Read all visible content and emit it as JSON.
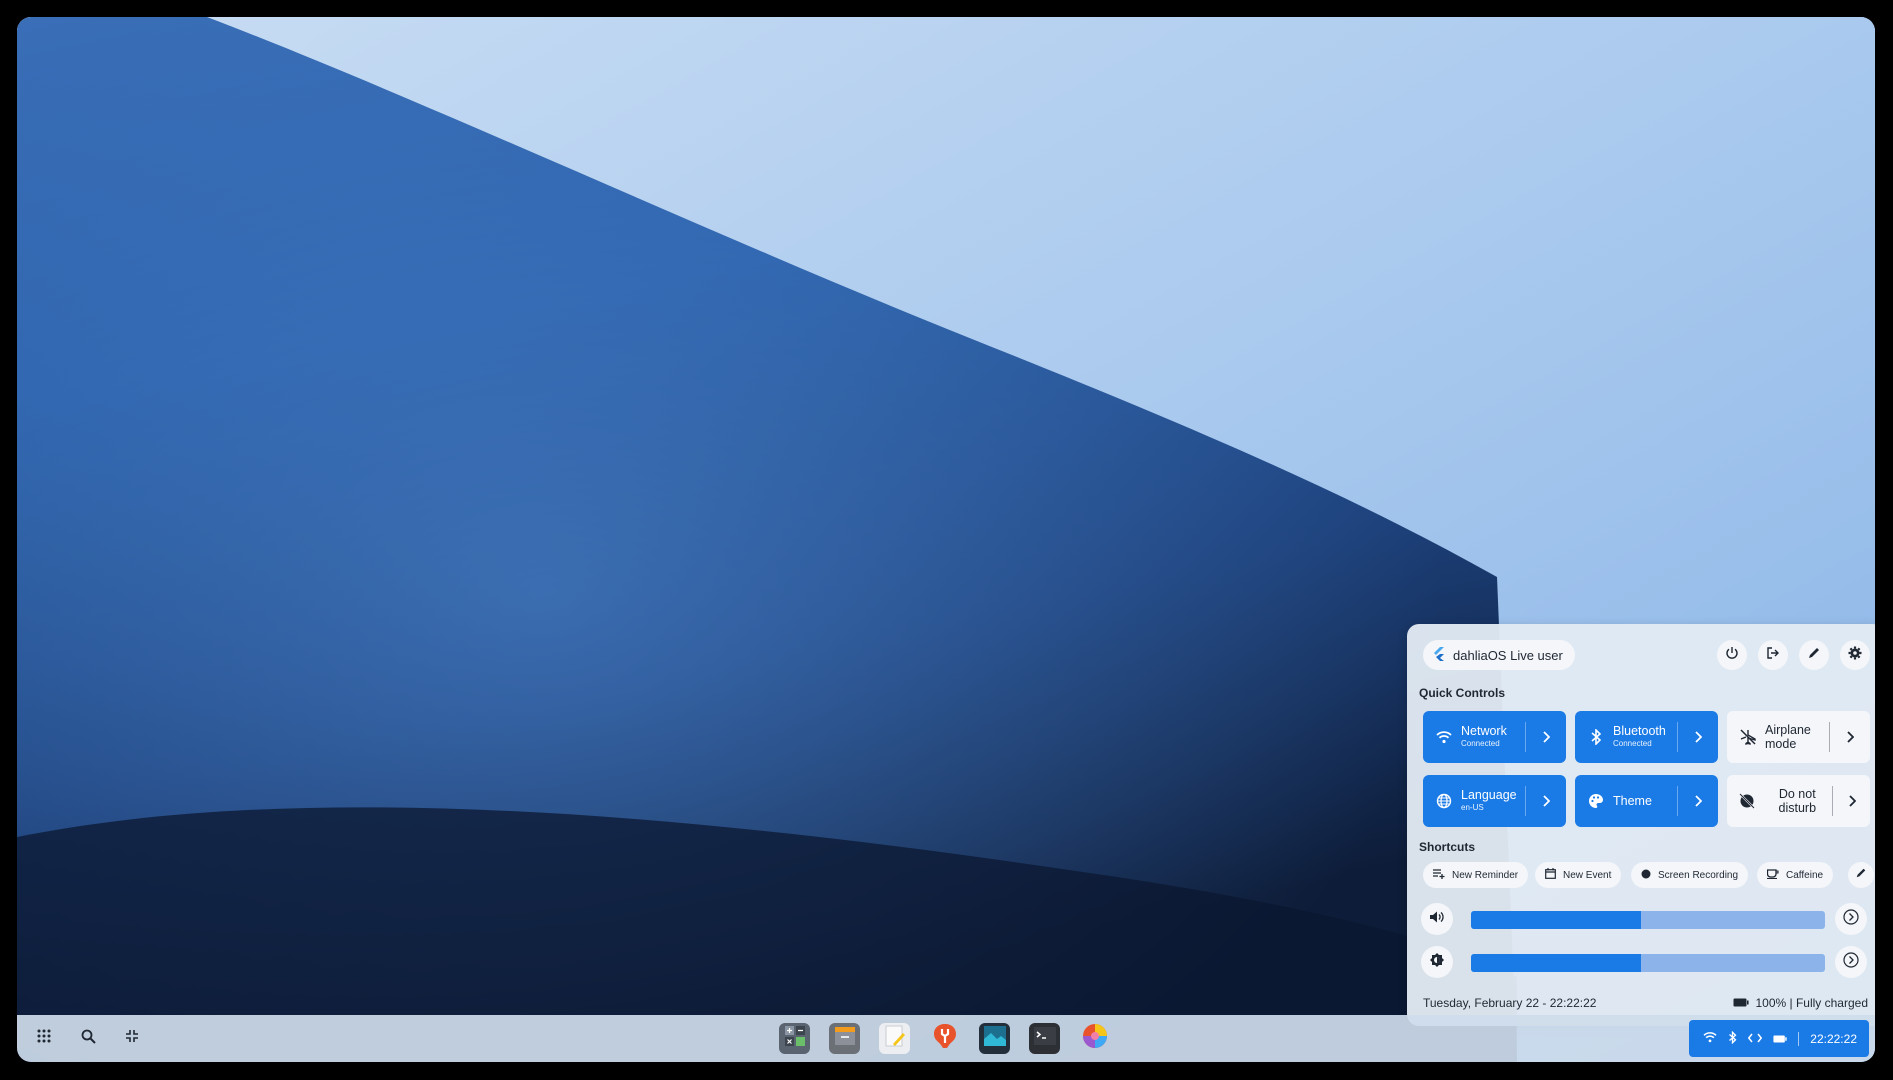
{
  "panel": {
    "user_label": "dahliaOS Live user",
    "quick_controls_title": "Quick Controls",
    "shortcuts_title": "Shortcuts",
    "tiles": [
      {
        "label": "Network",
        "sub": "Connected",
        "icon": "wifi-icon",
        "active": true
      },
      {
        "label": "Bluetooth",
        "sub": "Connected",
        "icon": "bluetooth-icon",
        "active": true
      },
      {
        "label": "Airplane mode",
        "sub": "",
        "icon": "airplane-off-icon",
        "active": false
      },
      {
        "label": "Language",
        "sub": "en-US",
        "icon": "globe-icon",
        "active": true
      },
      {
        "label": "Theme",
        "sub": "",
        "icon": "palette-icon",
        "active": true
      },
      {
        "label": "Do not disturb",
        "sub": "",
        "icon": "dnd-off-icon",
        "active": false
      }
    ],
    "shortcuts": [
      {
        "label": "New Reminder",
        "icon": "playlist-add-icon"
      },
      {
        "label": "New Event",
        "icon": "calendar-icon"
      },
      {
        "label": "Screen Recording",
        "icon": "record-icon"
      },
      {
        "label": "Caffeine",
        "icon": "coffee-icon"
      }
    ],
    "volume_level": 0.48,
    "brightness_level": 0.48,
    "date_time": "Tuesday, February 22 - 22:22:22",
    "battery": "100% | Fully charged"
  },
  "taskbar": {
    "left_icons": [
      "launcher-grid-icon",
      "search-icon",
      "overview-icon"
    ],
    "apps": [
      "calculator-app",
      "files-app",
      "notes-app",
      "settings-app",
      "media-app",
      "terminal-app",
      "graft-app"
    ],
    "tray_time": "22:22:22"
  },
  "colors": {
    "accent": "#1a7ae6",
    "panel_bg": "#e2eaf3",
    "track": "#8cb4ea"
  }
}
